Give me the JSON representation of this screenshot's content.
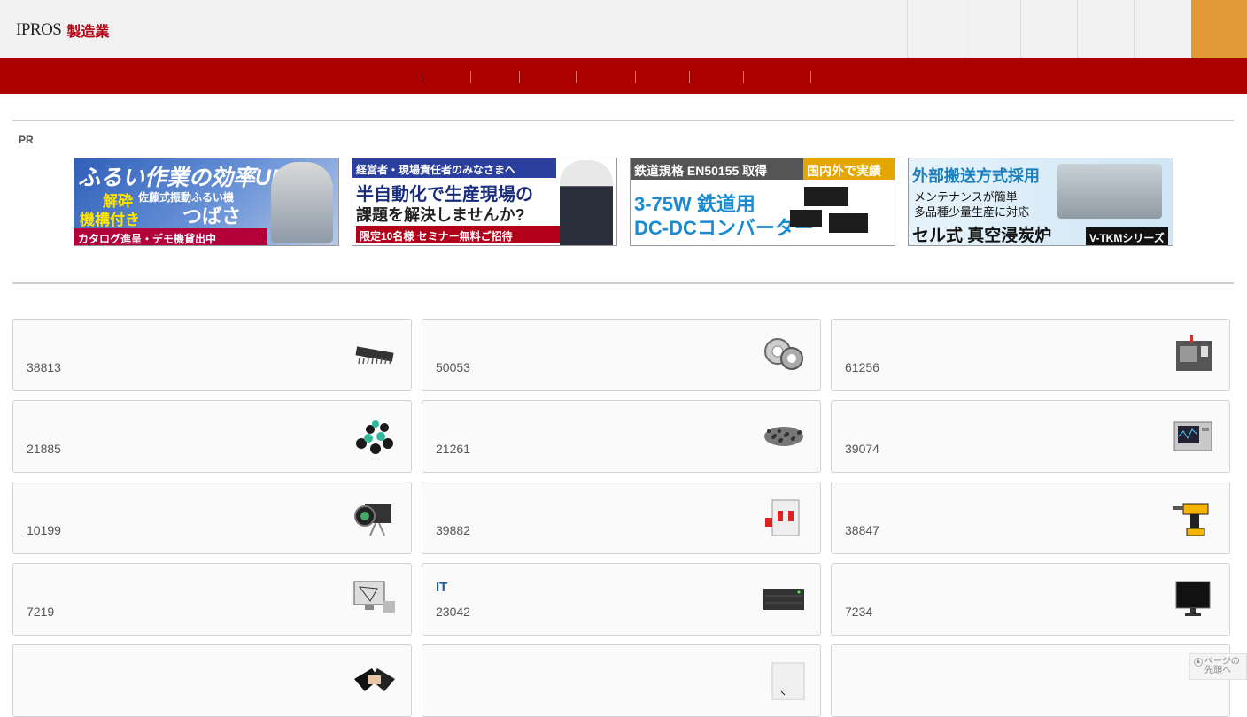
{
  "header": {
    "logo_text": "IPROS",
    "logo_sub": "製造業",
    "brand_color": "#aa0000",
    "accent_color": "#e29a37",
    "nav_icons": [
      "search-icon",
      "user-icon",
      "heart-icon",
      "cart-icon",
      "bell-icon"
    ]
  },
  "ads": {
    "label": "PR",
    "banners": [
      {
        "lines": [
          "ふるい作業の効率UP",
          "解砕",
          "機構付き",
          "佐藤式振動ふるい機",
          "つばさ",
          "カタログ進呈・デモ機貸出中"
        ]
      },
      {
        "lines": [
          "経営者・現場責任者のみなさまへ",
          "半自動化で生産現場の",
          "課題を解決しませんか?",
          "限定10名様 セミナー無料ご招待"
        ]
      },
      {
        "lines": [
          "鉄道規格 EN50155 取得",
          "国内外で実績",
          "3-75W 鉄道用",
          "DC-DCコンバーター"
        ]
      },
      {
        "lines": [
          "外部搬送方式採用",
          "メンテナンスが簡単",
          "多品種少量生産に対応",
          "セル式 真空浸炭炉",
          "V-TKMシリーズ"
        ]
      }
    ]
  },
  "categories": [
    {
      "title": "",
      "count": "38813",
      "icon": "ic-chip-icon"
    },
    {
      "title": "",
      "count": "50053",
      "icon": "bearing-icon"
    },
    {
      "title": "",
      "count": "61256",
      "icon": "cnc-machine-icon"
    },
    {
      "title": "",
      "count": "21885",
      "icon": "molecule-icon"
    },
    {
      "title": "",
      "count": "21261",
      "icon": "pellets-icon"
    },
    {
      "title": "",
      "count": "39074",
      "icon": "oscilloscope-icon"
    },
    {
      "title": "",
      "count": "10199",
      "icon": "camera-icon"
    },
    {
      "title": "",
      "count": "39882",
      "icon": "breaker-icon"
    },
    {
      "title": "",
      "count": "38847",
      "icon": "drill-icon"
    },
    {
      "title": "",
      "count": "7219",
      "icon": "cad-monitor-icon"
    },
    {
      "title": "IT",
      "count": "23042",
      "icon": "server-icon"
    },
    {
      "title": "",
      "count": "7234",
      "icon": "display-monitor-icon"
    },
    {
      "title": "",
      "count": "",
      "icon": "handshake-icon"
    },
    {
      "title": "",
      "count": "",
      "icon": "document-icon"
    },
    {
      "title": "",
      "count": "",
      "icon": "blank-icon"
    }
  ],
  "page_top": {
    "line1": "ページの",
    "line2": "先頭へ"
  }
}
